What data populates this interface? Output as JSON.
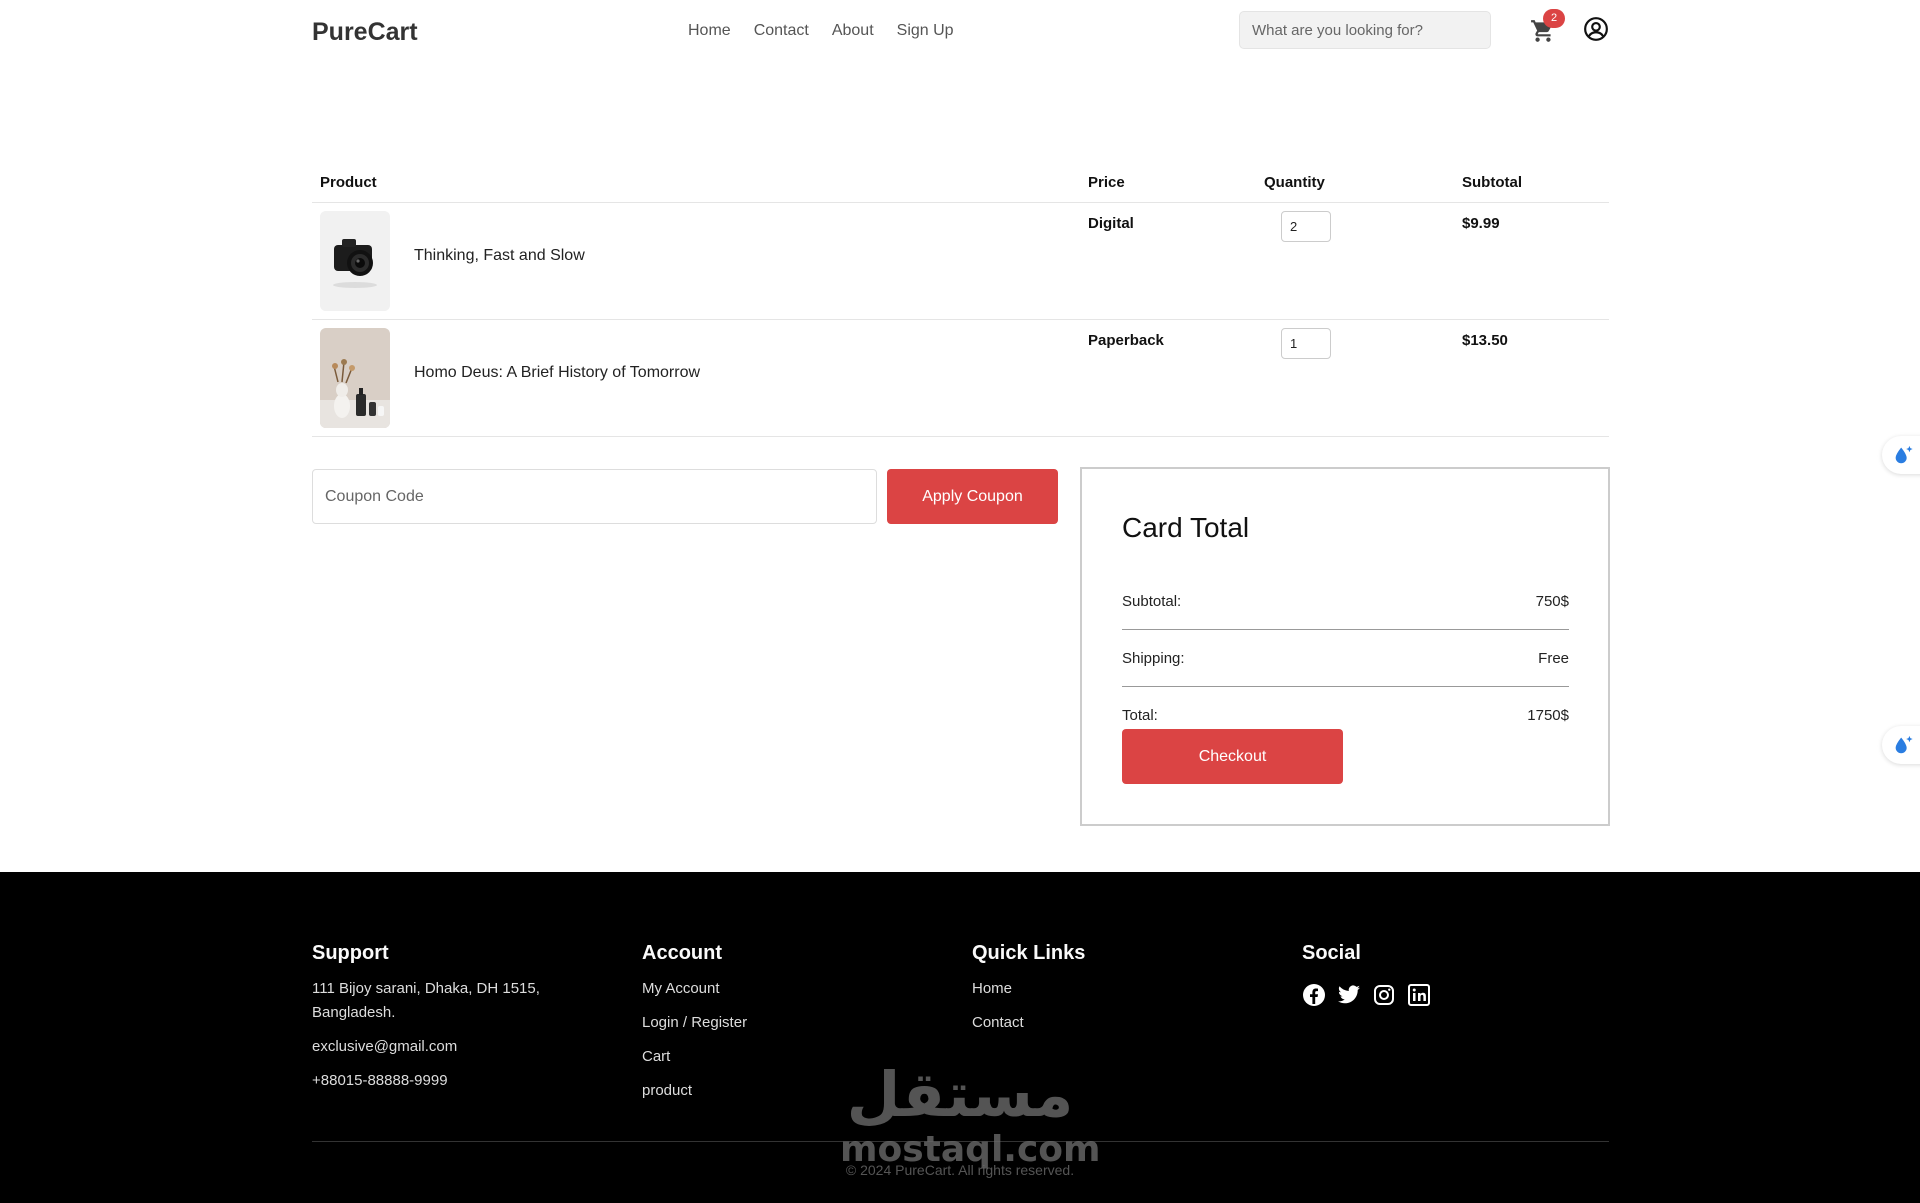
{
  "header": {
    "logo": "PureCart",
    "nav": [
      "Home",
      "Contact",
      "About",
      "Sign Up"
    ],
    "search_placeholder": "What are you looking for?",
    "cart_count": "2"
  },
  "table": {
    "headers": {
      "product": "Product",
      "price": "Price",
      "quantity": "Quantity",
      "subtotal": "Subtotal"
    },
    "rows": [
      {
        "name": "Thinking, Fast and Slow",
        "price": "Digital",
        "quantity": "2",
        "subtotal": "$9.99",
        "image": "camera"
      },
      {
        "name": "Homo Deus: A Brief History of Tomorrow",
        "price": "Paperback",
        "quantity": "1",
        "subtotal": "$13.50",
        "image": "vases"
      }
    ]
  },
  "coupon": {
    "placeholder": "Coupon Code",
    "button": "Apply Coupon"
  },
  "totals": {
    "title": "Card Total",
    "subtotal_label": "Subtotal:",
    "subtotal_value": "750$",
    "shipping_label": "Shipping:",
    "shipping_value": "Free",
    "total_label": "Total:",
    "total_value": "1750$",
    "checkout": "Checkout"
  },
  "footer": {
    "support": {
      "title": "Support",
      "address": "111 Bijoy sarani, Dhaka, DH 1515, Bangladesh.",
      "email": "exclusive@gmail.com",
      "phone": "+88015-88888-9999"
    },
    "account": {
      "title": "Account",
      "links": [
        "My Account",
        "Login / Register",
        "Cart",
        "product"
      ]
    },
    "quick_links": {
      "title": "Quick Links",
      "links": [
        "Home",
        "Contact"
      ]
    },
    "social": {
      "title": "Social",
      "icons": [
        "facebook-icon",
        "twitter-icon",
        "instagram-icon",
        "linkedin-icon"
      ]
    },
    "copyright": "© 2024 PureCart. All rights reserved."
  },
  "watermark": {
    "arabic": "مستقل",
    "latin": "mostaql.com"
  },
  "colors": {
    "accent": "#db4444",
    "footer_bg": "#000000"
  }
}
